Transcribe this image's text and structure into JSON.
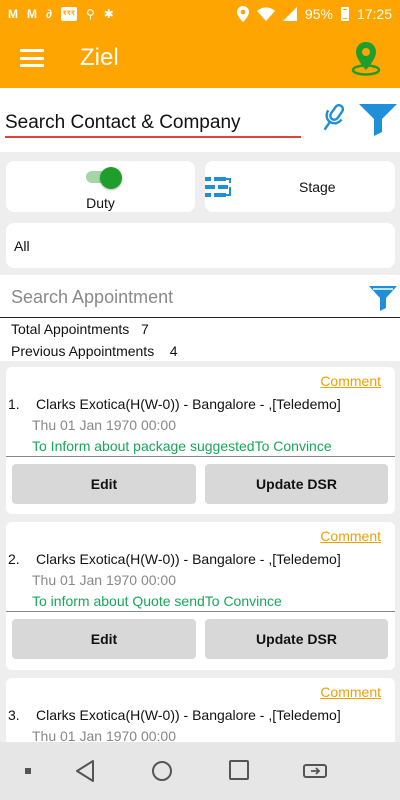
{
  "status_bar": {
    "left_icons": [
      "m-icon",
      "m-icon",
      "link-icon",
      "finance-box-icon",
      "usb-icon",
      "android-debug-icon"
    ],
    "left_icon_glyphs": [
      "M",
      "M",
      "∂",
      "₹",
      "⚲",
      "✱"
    ],
    "finance_box_text": "₹₹₹",
    "battery": "95%",
    "time": "17:25"
  },
  "app_bar": {
    "title": "Ziel",
    "accent_color": "#ffa502"
  },
  "contact_search": {
    "value": "Search Contact & Company",
    "underline_color": "#d9463a",
    "icons": [
      "microphone-icon",
      "filter-icon"
    ]
  },
  "duty": {
    "label": "Duty",
    "enabled": true
  },
  "stage": {
    "label": "Stage",
    "icon": "workflow-icon"
  },
  "filter_select": {
    "selected": "All"
  },
  "appointment_search": {
    "placeholder": "Search Appointment",
    "icon": "filter-icon"
  },
  "stats": {
    "total_label": "Total Appointments",
    "total_value": "7",
    "previous_label": "Previous Appointments",
    "previous_value": "4"
  },
  "appointments": [
    {
      "number": "1.",
      "title": "Clarks  Exotica(H(W-0)) - Bangalore - ,[Teledemo]",
      "date": "Thu 01 Jan 1970  00:00",
      "purpose": "To Inform about package suggestedTo Convince",
      "comment": "Comment",
      "edit": "Edit",
      "update": "Update DSR"
    },
    {
      "number": "2.",
      "title": "Clarks  Exotica(H(W-0)) - Bangalore - ,[Teledemo]",
      "date": "Thu 01 Jan 1970  00:00",
      "purpose": "To inform about Quote sendTo Convince",
      "comment": "Comment",
      "edit": "Edit",
      "update": "Update DSR"
    },
    {
      "number": "3.",
      "title": "Clarks  Exotica(H(W-0)) - Bangalore - ,[Teledemo]",
      "date": "Thu 01 Jan 1970  00:00",
      "comment": "Comment"
    }
  ],
  "colors": {
    "comment": "#f0a000",
    "purpose": "#17a75a",
    "toggle_on": "#1f9e2e",
    "icon_blue": "#1e8fd8"
  },
  "nav_bar": {
    "icons": [
      "dot-icon",
      "back-icon",
      "home-icon",
      "recents-icon",
      "rotate-icon"
    ]
  }
}
